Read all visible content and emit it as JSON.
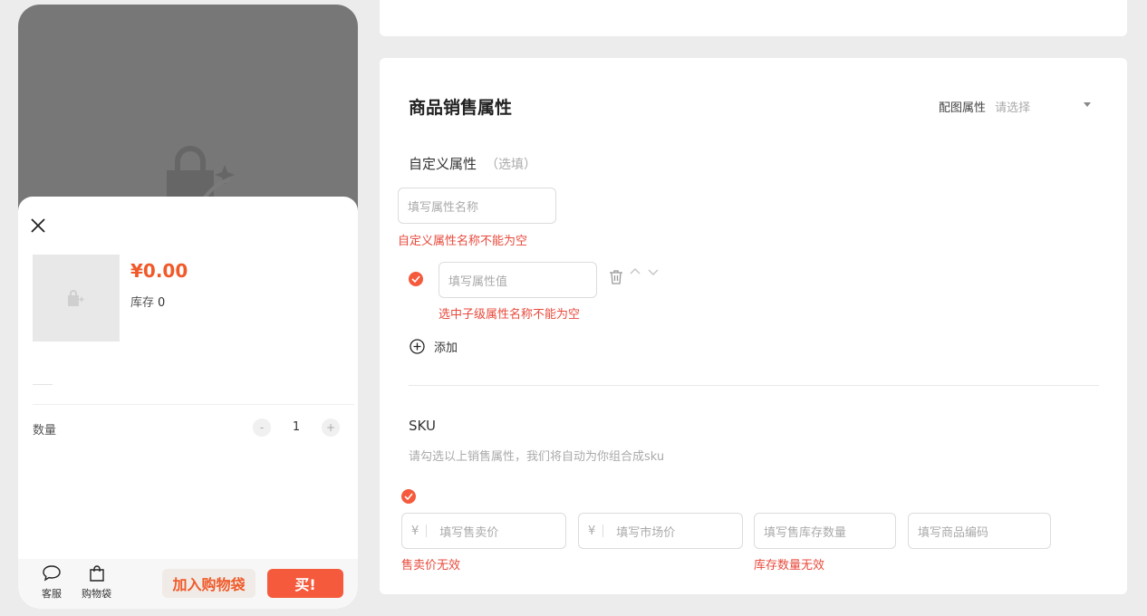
{
  "preview": {
    "price": "¥0.00",
    "stock_label": "库存",
    "stock_value": "0",
    "quantity_label": "数量",
    "quantity": "1",
    "minus": "-",
    "plus": "+",
    "bottom_bar": {
      "service_label": "客服",
      "bag_label": "购物袋",
      "add_to_bag": "加入购物袋",
      "buy": "买!"
    }
  },
  "sales_attrs": {
    "title": "商品销售属性",
    "image_attr_label": "配图属性",
    "image_attr_placeholder": "请选择",
    "custom_attr_label": "自定义属性",
    "custom_attr_optional": "（选填）",
    "attr_name_placeholder": "填写属性名称",
    "attr_name_error": "自定义属性名称不能为空",
    "attr_value_placeholder": "填写属性值",
    "attr_value_error": "选中子级属性名称不能为空",
    "add_label": "添加"
  },
  "sku": {
    "title": "SKU",
    "hint": "请勾选以上销售属性，我们将自动为你组合成sku",
    "currency": "¥",
    "price_placeholder": "填写售卖价",
    "market_price_placeholder": "填写市场价",
    "stock_placeholder": "填写售库存数量",
    "code_placeholder": "填写商品编码",
    "price_error": "售卖价无效",
    "stock_error": "库存数量无效"
  },
  "colors": {
    "accent": "#f55a3c",
    "price": "#f05a2a",
    "error": "#e84a3c"
  }
}
